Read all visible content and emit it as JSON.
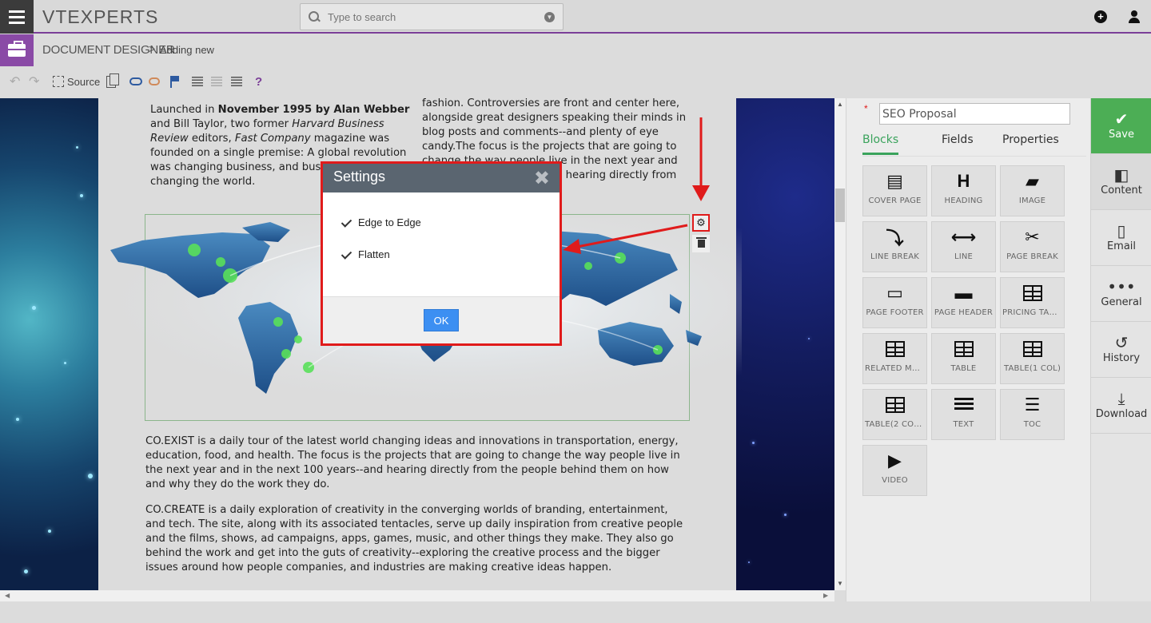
{
  "app": {
    "logo_text": "VTEXPERTS"
  },
  "search": {
    "placeholder": "Type to search"
  },
  "breadcrumb": {
    "module": "DOCUMENT DESIGNER",
    "separator": ">",
    "current": "Adding new"
  },
  "toolbar": {
    "source_label": "Source",
    "help_label": "?"
  },
  "document": {
    "col1_html": "Launched in <b>November 1995 by Alan Webber</b> and Bill Taylor, two former <i>Harvard Business Review</i> editors, <i>Fast Company</i> magazine was founded on a single premise: A global revolution was changing business, and business was changing the world.",
    "col2_text": "fashion. Controversies are front and center here, alongside great designers speaking their minds in blog posts and comments--and plenty of eye candy.The focus is the projects that are going to change the way people live in the next year and in the next 100 years--and hearing directly from",
    "para1_lead": "CO.EXIST",
    "para1_text": " is a daily tour of the latest world changing ideas and innovations in transportation, energy, education, food, and health. The focus is the projects that are going to change the way people live in the next year and in the next 100 years--and hearing directly from the people behind them on how and why they do the work they do.",
    "para2_lead": "CO.CREATE",
    "para2_text": " is a daily exploration of creativity in the converging worlds of branding, entertainment, and tech. The site, along with its associated tentacles, serve up daily inspiration from creative people and the films, shows, ad campaigns, apps, games, music, and other things they make. They also go behind the work and get into the guts of creativity--exploring the creative process and the bigger issues around how people companies, and industries are making creative ideas happen."
  },
  "modal": {
    "title": "Settings",
    "close_label": "✖",
    "options": [
      {
        "label": "Edge to Edge",
        "checked": true
      },
      {
        "label": "Flatten",
        "checked": true
      }
    ],
    "ok_label": "OK"
  },
  "panel": {
    "template_name": "SEO Proposal",
    "tabs": [
      "Blocks",
      "Fields",
      "Properties"
    ],
    "active_tab": "Blocks",
    "blocks": [
      {
        "label": "COVER PAGE",
        "icon": "cover-page-icon"
      },
      {
        "label": "HEADING",
        "icon": "heading-icon"
      },
      {
        "label": "IMAGE",
        "icon": "image-icon"
      },
      {
        "label": "LINE BREAK",
        "icon": "line-break-icon"
      },
      {
        "label": "LINE",
        "icon": "line-icon"
      },
      {
        "label": "PAGE BREAK",
        "icon": "page-break-icon"
      },
      {
        "label": "PAGE FOOTER",
        "icon": "page-footer-icon"
      },
      {
        "label": "PAGE HEADER",
        "icon": "page-header-icon"
      },
      {
        "label": "PRICING TAB...",
        "icon": "pricing-table-icon"
      },
      {
        "label": "RELATED MO...",
        "icon": "related-modules-icon"
      },
      {
        "label": "TABLE",
        "icon": "table-icon"
      },
      {
        "label": "TABLE(1 COL)",
        "icon": "table-1col-icon"
      },
      {
        "label": "TABLE(2 COL...",
        "icon": "table-2col-icon"
      },
      {
        "label": "TEXT",
        "icon": "text-icon"
      },
      {
        "label": "TOC",
        "icon": "toc-icon"
      },
      {
        "label": "VIDEO",
        "icon": "video-icon"
      }
    ]
  },
  "sidebar": {
    "items": [
      {
        "label": "Save",
        "icon": "check-circle-icon"
      },
      {
        "label": "Content",
        "icon": "content-icon"
      },
      {
        "label": "Email",
        "icon": "email-icon"
      },
      {
        "label": "General",
        "icon": "more-icon"
      },
      {
        "label": "History",
        "icon": "history-icon"
      },
      {
        "label": "Download",
        "icon": "download-icon"
      }
    ]
  },
  "colors": {
    "accent": "#7b3f98",
    "save": "#4cae55",
    "annotation": "#e01b1b",
    "ok_button": "#3c8ff2"
  }
}
